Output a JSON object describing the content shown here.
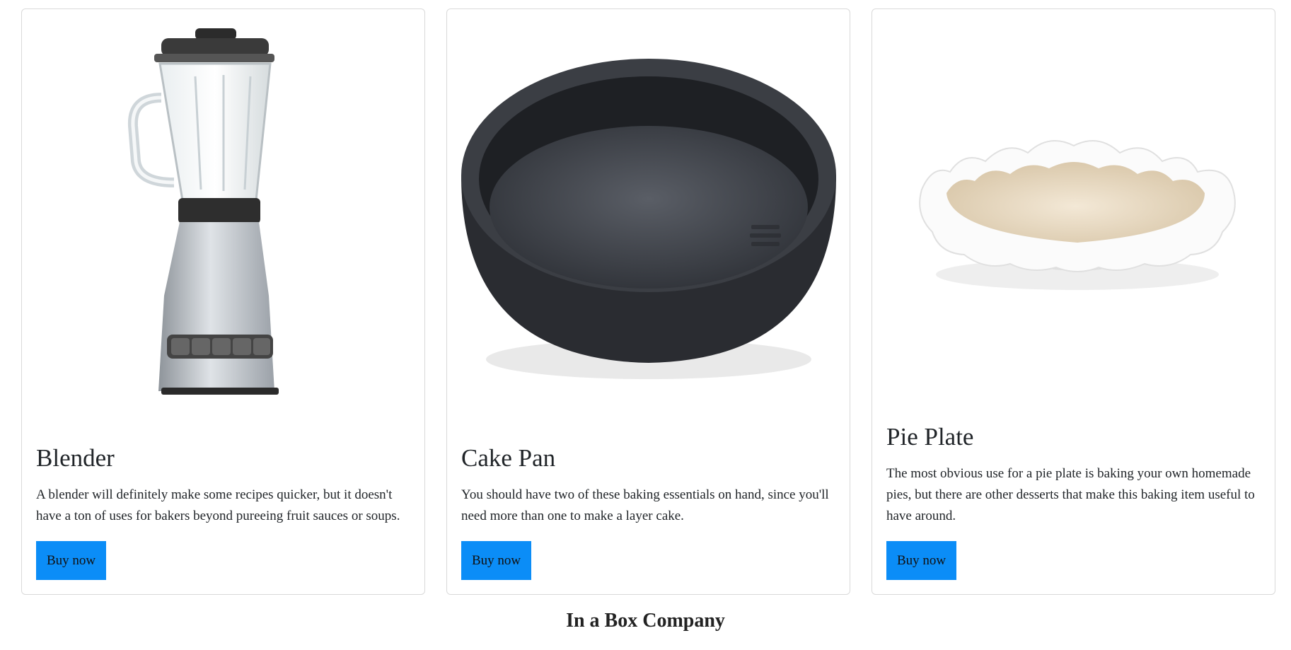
{
  "products": [
    {
      "name": "Blender",
      "description": "A blender will definitely make some recipes quicker, but it doesn't have a ton of uses for bakers beyond pureeing fruit sauces or soups.",
      "button_label": "Buy now",
      "image_icon": "blender-image"
    },
    {
      "name": "Cake Pan",
      "description": "You should have two of these baking essentials on hand, since you'll need more than one to make a layer cake.",
      "button_label": "Buy now",
      "image_icon": "cake-pan-image"
    },
    {
      "name": "Pie Plate",
      "description": "The most obvious use for a pie plate is baking your own homemade pies, but there are other desserts that make this baking item useful to have around.",
      "button_label": "Buy now",
      "image_icon": "pie-plate-image"
    }
  ],
  "footer": {
    "company": "In a Box Company"
  },
  "colors": {
    "button": "#0b8df7",
    "border": "#d9d9d9",
    "text": "#212529"
  }
}
